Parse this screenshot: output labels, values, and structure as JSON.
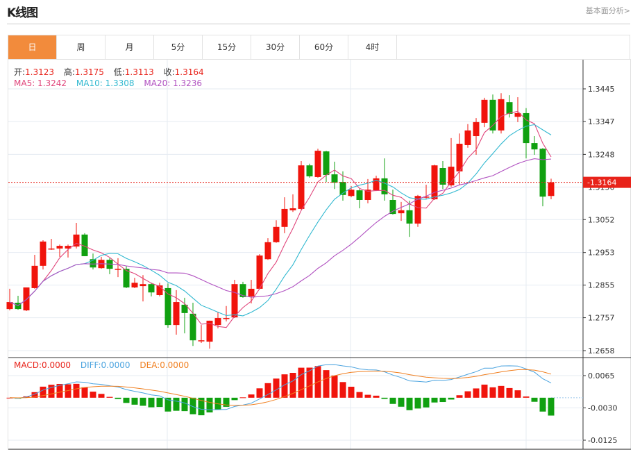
{
  "header": {
    "title": "K线图",
    "link": "基本面分析>"
  },
  "tabs": [
    {
      "label": "日",
      "active": true
    },
    {
      "label": "周"
    },
    {
      "label": "月"
    },
    {
      "label": "5分"
    },
    {
      "label": "15分"
    },
    {
      "label": "30分"
    },
    {
      "label": "60分"
    },
    {
      "label": "4时"
    }
  ],
  "ohlc_legend": {
    "open_label": "开:",
    "open": "1.3123",
    "high_label": "高:",
    "high": "1.3175",
    "low_label": "低:",
    "low": "1.3113",
    "close_label": "收:",
    "close": "1.3164"
  },
  "ma_legend": {
    "ma5": "MA5: 1.3242",
    "ma10": "MA10: 1.3308",
    "ma20": "MA20: 1.3236"
  },
  "macd_legend": {
    "macd": "MACD:0.0000",
    "diff": "DIFF:0.0000",
    "dea": "DEA:0.0000"
  },
  "current_price": "1.3164",
  "colors": {
    "up": "#f0140c",
    "down": "#10a010",
    "ma5": "#e0457b",
    "ma10": "#30b8d0",
    "ma20": "#b050c0",
    "diff": "#4aa3df",
    "dea": "#f07f1f",
    "active_tab": "#f28b3c"
  },
  "chart_data": [
    {
      "type": "candlestick",
      "ylim": [
        1.2658,
        1.3445
      ],
      "y_ticks": [
        "1.3445",
        "1.3347",
        "1.3248",
        "1.3150",
        "1.3052",
        "1.2953",
        "1.2855",
        "1.2757",
        "1.2658"
      ],
      "grid": true,
      "ohlc": [
        [
          1.2783,
          1.2844,
          1.2779,
          1.2804
        ],
        [
          1.2802,
          1.2823,
          1.2781,
          1.2783
        ],
        [
          1.2779,
          1.2848,
          1.2777,
          1.2848
        ],
        [
          1.2846,
          1.2946,
          1.2844,
          1.2913
        ],
        [
          1.2913,
          1.299,
          1.2902,
          1.2986
        ],
        [
          1.2963,
          1.2994,
          1.2961,
          1.2965
        ],
        [
          1.2965,
          1.2977,
          1.294,
          1.2973
        ],
        [
          1.2965,
          1.2977,
          1.2938,
          1.2973
        ],
        [
          1.2971,
          1.3042,
          1.2965,
          1.3007
        ],
        [
          1.3007,
          1.3011,
          1.2942,
          1.2942
        ],
        [
          1.2933,
          1.295,
          1.2902,
          1.2908
        ],
        [
          1.2906,
          1.294,
          1.2904,
          1.2931
        ],
        [
          1.2931,
          1.2936,
          1.2888,
          1.2904
        ],
        [
          1.2902,
          1.2936,
          1.2879,
          1.2904
        ],
        [
          1.2904,
          1.2913,
          1.2846,
          1.2848
        ],
        [
          1.2848,
          1.2877,
          1.2846,
          1.2862
        ],
        [
          1.2852,
          1.2885,
          1.2806,
          1.2858
        ],
        [
          1.2858,
          1.2862,
          1.2821,
          1.2833
        ],
        [
          1.2825,
          1.2862,
          1.2821,
          1.2854
        ],
        [
          1.2846,
          1.286,
          1.2727,
          1.2735
        ],
        [
          1.2735,
          1.284,
          1.2706,
          1.2804
        ],
        [
          1.2796,
          1.2817,
          1.271,
          1.2771
        ],
        [
          1.2769,
          1.2802,
          1.2672,
          1.2689
        ],
        [
          1.2687,
          1.2735,
          1.2681,
          1.2689
        ],
        [
          1.2685,
          1.2748,
          1.2664,
          1.2748
        ],
        [
          1.2735,
          1.2775,
          1.2725,
          1.2756
        ],
        [
          1.2754,
          1.2792,
          1.2746,
          1.2756
        ],
        [
          1.2758,
          1.2871,
          1.2756,
          1.2858
        ],
        [
          1.2858,
          1.2865,
          1.2817,
          1.2819
        ],
        [
          1.2821,
          1.2871,
          1.28,
          1.2844
        ],
        [
          1.2844,
          1.2948,
          1.2842,
          1.2944
        ],
        [
          1.2933,
          1.2996,
          1.2931,
          1.2984
        ],
        [
          1.2984,
          1.305,
          1.2982,
          1.303
        ],
        [
          1.303,
          1.3119,
          1.3011,
          1.3084
        ],
        [
          1.308,
          1.3128,
          1.3075,
          1.3086
        ],
        [
          1.3084,
          1.3228,
          1.3082,
          1.3215
        ],
        [
          1.3215,
          1.322,
          1.3178,
          1.3182
        ],
        [
          1.318,
          1.3265,
          1.3178,
          1.3259
        ],
        [
          1.3257,
          1.3259,
          1.3165,
          1.3186
        ],
        [
          1.3188,
          1.3226,
          1.3144,
          1.3163
        ],
        [
          1.3165,
          1.3197,
          1.3109,
          1.3126
        ],
        [
          1.3123,
          1.3153,
          1.3119,
          1.3142
        ],
        [
          1.314,
          1.3144,
          1.3086,
          1.3111
        ],
        [
          1.3111,
          1.3174,
          1.3101,
          1.3142
        ],
        [
          1.314,
          1.3184,
          1.3138,
          1.3176
        ],
        [
          1.3176,
          1.3236,
          1.3109,
          1.3128
        ],
        [
          1.3111,
          1.3142,
          1.3067,
          1.3069
        ],
        [
          1.3071,
          1.3105,
          1.3048,
          1.308
        ],
        [
          1.308,
          1.3109,
          1.3,
          1.304
        ],
        [
          1.304,
          1.3126,
          1.303,
          1.3123
        ],
        [
          1.3119,
          1.3157,
          1.3115,
          1.3121
        ],
        [
          1.3113,
          1.3217,
          1.3111,
          1.3215
        ],
        [
          1.3207,
          1.3228,
          1.3144,
          1.3157
        ],
        [
          1.3155,
          1.3297,
          1.3151,
          1.3211
        ],
        [
          1.3197,
          1.3311,
          1.3155,
          1.328
        ],
        [
          1.3276,
          1.3339,
          1.3268,
          1.332
        ],
        [
          1.3303,
          1.3357,
          1.3247,
          1.3345
        ],
        [
          1.3343,
          1.3418,
          1.333,
          1.3412
        ],
        [
          1.3412,
          1.3428,
          1.3311,
          1.332
        ],
        [
          1.332,
          1.3432,
          1.3311,
          1.3414
        ],
        [
          1.3405,
          1.3426,
          1.3359,
          1.337
        ],
        [
          1.3361,
          1.342,
          1.3345,
          1.3372
        ],
        [
          1.3372,
          1.3387,
          1.3236,
          1.3282
        ],
        [
          1.3282,
          1.3303,
          1.3247,
          1.3263
        ],
        [
          1.3265,
          1.3267,
          1.3092,
          1.3121
        ],
        [
          1.3123,
          1.3175,
          1.3113,
          1.3164
        ]
      ],
      "series": [
        {
          "name": "MA5"
        },
        {
          "name": "MA10"
        },
        {
          "name": "MA20"
        }
      ]
    },
    {
      "type": "macd",
      "ylim": [
        -0.0125,
        0.0065
      ],
      "y_ticks": [
        "0.0065",
        "-0.0030",
        "-0.0125"
      ],
      "series": [
        {
          "name": "MACD"
        },
        {
          "name": "DIFF"
        },
        {
          "name": "DEA"
        }
      ]
    }
  ]
}
